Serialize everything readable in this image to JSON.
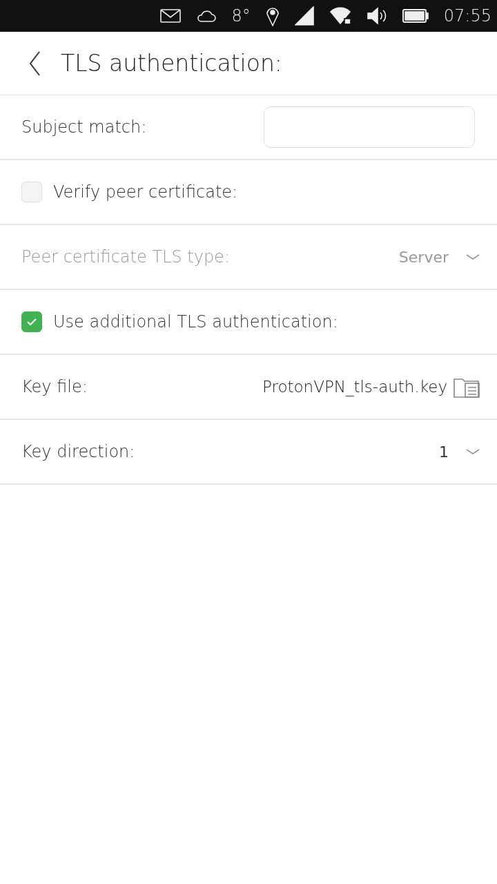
{
  "status_bar": {
    "temperature": "8°",
    "time": "07:55"
  },
  "header": {
    "title": "TLS authentication:"
  },
  "rows": [
    {
      "kind": "field",
      "label": "Subject match:",
      "disabled": false
    },
    {
      "kind": "checkbox",
      "label": "Verify peer certificate:",
      "checked": false,
      "disabled": false
    },
    {
      "kind": "dropdown",
      "label": "Peer certificate TLS type:",
      "value": "Server",
      "disabled": true
    },
    {
      "kind": "checkbox",
      "label": "Use additional TLS authentication:",
      "checked": true,
      "disabled": false
    },
    {
      "kind": "file",
      "label": "Key file:",
      "value": "ProtonVPN_tls-auth.key",
      "disabled": false
    },
    {
      "kind": "dropdown",
      "label": "Key direction:",
      "value": "1",
      "disabled": false
    }
  ]
}
